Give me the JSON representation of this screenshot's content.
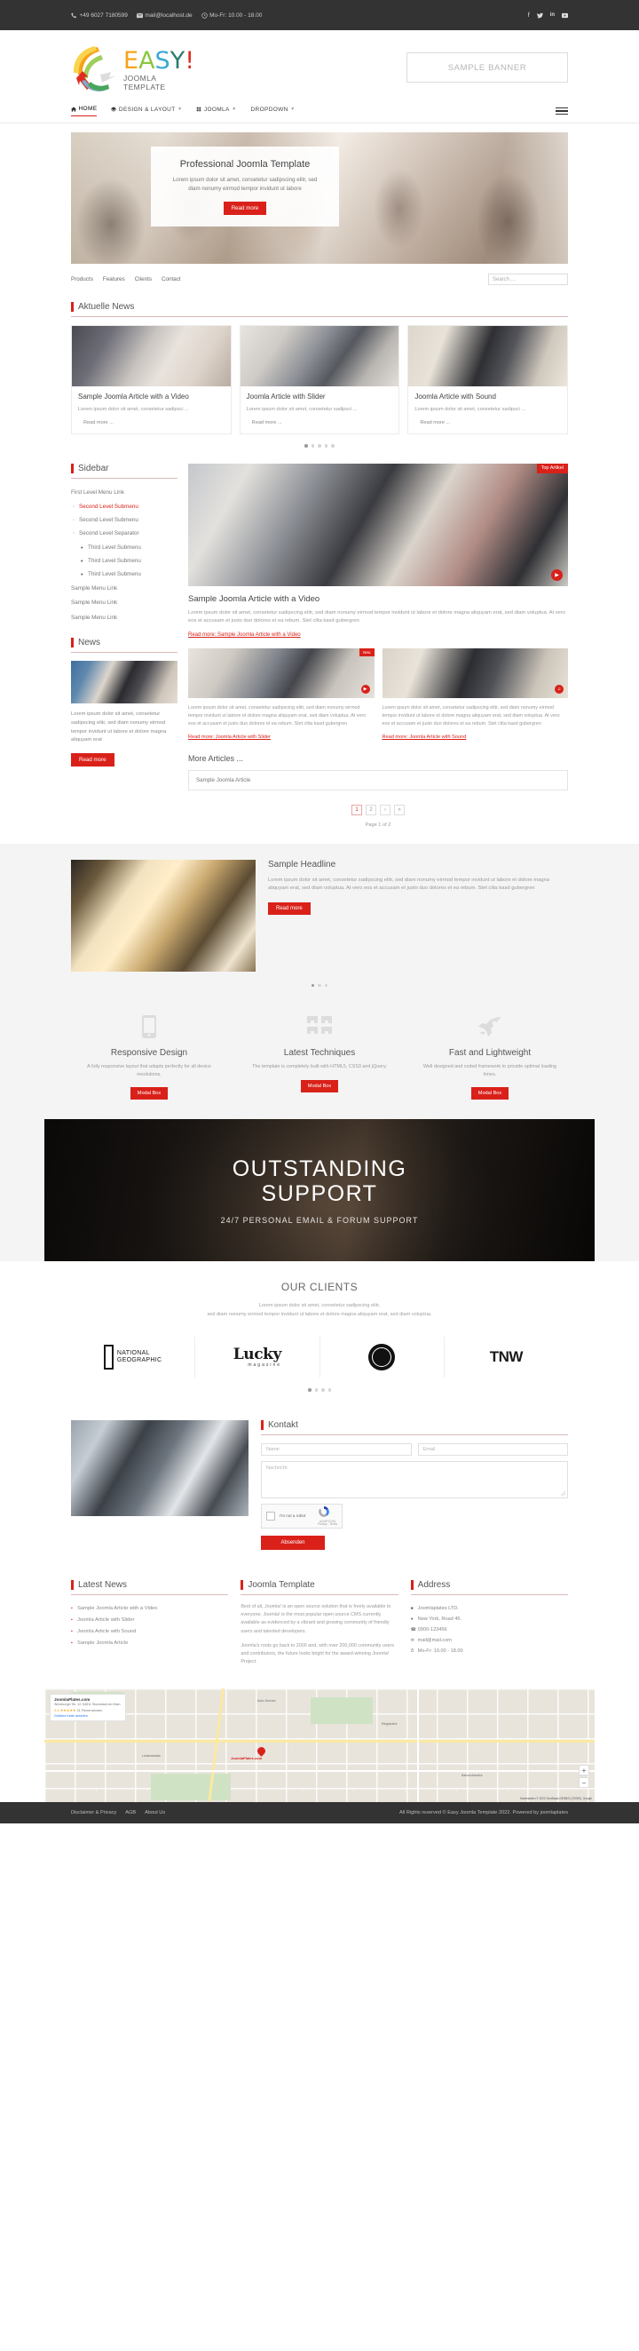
{
  "topbar": {
    "phone": "+49 6027 7180599",
    "email": "mail@localhost.de",
    "hours": "Mo-Fr: 10.00 - 18.00",
    "social": [
      "facebook-icon",
      "twitter-icon",
      "linkedin-icon",
      "youtube-icon"
    ]
  },
  "header": {
    "logo_main": "EASY!",
    "logo_sub_line1": "JOOMLA",
    "logo_sub_line2": "TEMPLATE",
    "banner_text": "SAMPLE BANNER"
  },
  "nav": {
    "items": [
      {
        "label": "HOME",
        "icon": "home-icon",
        "caret": false,
        "active": true
      },
      {
        "label": "DESIGN & LAYOUT",
        "icon": "layers-icon",
        "caret": true,
        "active": false
      },
      {
        "label": "JOOMLA",
        "icon": "joomla-icon",
        "caret": true,
        "active": false
      },
      {
        "label": "DROPDOWN",
        "icon": "",
        "caret": true,
        "active": false
      }
    ],
    "burger": "hamburger-menu-icon"
  },
  "slider": {
    "title": "Professional Joomla Template",
    "text": "Lorem ipsum dolor sit amet, consetetur sadipscing elitr, sed diam nonumy eirmod tempor invidunt ut labore",
    "button": "Read more"
  },
  "submenu": {
    "items": [
      "Products",
      "Features",
      "Clients",
      "Contact"
    ],
    "search_placeholder": "Search ..."
  },
  "news": {
    "heading": "Aktuelle News",
    "cards": [
      {
        "title": "Sample Joomla Article with a Video",
        "text": "Lorem ipsum dolor sit amet, consetetur sadipsci ...",
        "more": "Read more ..."
      },
      {
        "title": "Joomla Article with Slider",
        "text": "Lorem ipsum dolor sit amet, consetetur sadipsci ...",
        "more": "Read more ..."
      },
      {
        "title": "Joomla Article with Sound",
        "text": "Lorem ipsum dolor sit amet, consetetur sadipsci ...",
        "more": "Read more ..."
      }
    ],
    "dots": 5,
    "active_dot": 1
  },
  "sidebar": {
    "heading": "Sidebar",
    "menu": [
      {
        "label": "First Level Menu Link",
        "level": 1,
        "active": false
      },
      {
        "label": "Second Level Submenu",
        "level": 2,
        "active": true
      },
      {
        "label": "Second Level Submenu",
        "level": 2,
        "active": false
      },
      {
        "label": "Second Level Separator",
        "level": 2,
        "active": false
      },
      {
        "label": "Third Level Submenu",
        "level": 3,
        "active": false
      },
      {
        "label": "Third Level Submenu",
        "level": 3,
        "active": false
      },
      {
        "label": "Third Level Submenu",
        "level": 3,
        "active": false
      },
      {
        "label": "Sample Menu Link",
        "level": 1,
        "active": false
      },
      {
        "label": "Sample Menu Link",
        "level": 1,
        "active": false
      },
      {
        "label": "Sample Menu Link",
        "level": 1,
        "active": false
      }
    ],
    "news_heading": "News",
    "news_text": "Lorem ipsum dolor sit amet, consetetur sadipscing elitr, sed diam nonumy eirmod tempor invidunt ut labore et dolore magna aliquyam erat",
    "news_button": "Read more"
  },
  "article": {
    "badge": "Top Artikel",
    "media_icon": "video-icon",
    "title": "Sample Joomla Article with a Video",
    "text": "Lorem ipsum dolor sit amet, consetetur sadipscing elitr, sed diam nonumy eirmod tempor invidunt ut labore et dolore magna aliquyam erat, sed diam voluptua. At vero eos et accusam et justo duo dolores et ea rebum. Stet clita kasd gubergren",
    "link": "Read more: Sample Joomla Article with a Video",
    "sub": [
      {
        "badge": "Neu",
        "media_icon": "slider-icon",
        "text": "Lorem ipsum dolor sit amet, consetetur sadipscing elitr, sed diam nonumy eirmod tempor invidunt ut labore et dolore magna aliquyam erat, sed diam voluptua. At vero eos et accusam et justo duo dolores et ea rebum. Stet clita kasd gubergren",
        "link": "Read more: Joomla Article with Slider"
      },
      {
        "badge": "",
        "media_icon": "sound-icon",
        "text": "Lorem ipsum dolor sit amet, consetetur sadipscing elitr, sed diam nonumy eirmod tempor invidunt ut labore et dolore magna aliquyam erat, sed diam voluptua. At vero eos et accusam et justo duo dolores et ea rebum. Stet clita kasd gubergren",
        "link": "Read more: Joomla Article with Sound"
      }
    ],
    "more_title": "More Articles ...",
    "more_item": "Sample Joomla Article",
    "pager": [
      "1",
      "2",
      "›",
      "»"
    ],
    "pager_current": "1",
    "page_info": "Page 1 of 2"
  },
  "feature": {
    "title": "Sample Headline",
    "text": "Lorem ipsum dolor sit amet, consetetur sadipscing elitr, sed diam nonumy eirmod tempor invidunt ut labore et dolore magna aliquyam erat, sed diam voluptua. At vero eos et accusam et justo duo dolores et ea rebum. Stet clita kasd gubergren",
    "button": "Read more",
    "dots": 3,
    "active_dot": 1
  },
  "services": [
    {
      "icon": "mobile-phone-icon",
      "title": "Responsive Design",
      "text": "A fully responsive layout that adapts perfectly for all device resolutions.",
      "button": "Modal Box"
    },
    {
      "icon": "blocks-icon",
      "title": "Latest Techniques",
      "text": "The template is completely built with HTML5, CSS3 and jQuery.",
      "button": "Modal Box"
    },
    {
      "icon": "rocket-icon",
      "title": "Fast and Lightweight",
      "text": "Well designed and coded framework to provide optimal loading times.",
      "button": "Modal Box"
    }
  ],
  "support": {
    "line1": "OUTSTANDING",
    "line2": "SUPPORT",
    "subtitle": "24/7 PERSONAL EMAIL & FORUM SUPPORT"
  },
  "clients": {
    "title": "OUR CLIENTS",
    "text_line1": "Lorem ipsum dolor sit amet, consetetur sadipscing elitr,",
    "text_line2": "sed diam nonumy eirmod tempor invidunt ut labore et dolore magna aliquyam erat, sed diam voluptua.",
    "logos": [
      {
        "name": "NATIONAL GEOGRAPHIC",
        "line1": "NATIONAL",
        "line2": "GEOGRAPHIC"
      },
      {
        "name": "Lucky magazine",
        "line1": "Lucky",
        "line2": "magazine"
      },
      {
        "name": "Starbucks",
        "line1": "",
        "line2": ""
      },
      {
        "name": "TNW",
        "line1": "TNW",
        "line2": ""
      }
    ],
    "dots": 4,
    "active_dot": 1
  },
  "contact": {
    "heading": "Kontakt",
    "name_placeholder": "Name",
    "email_placeholder": "Email",
    "message_placeholder": "Nachricht",
    "captcha_label": "I'm not a robot",
    "captcha_brand": "reCAPTCHA",
    "captcha_terms": "Privacy - Terms",
    "submit": "Absenden"
  },
  "footer": {
    "col1_heading": "Latest News",
    "col1_items": [
      "Sample Joomla Article with a Video",
      "Joomla Article with Slider",
      "Joomla Article with Sound",
      "Sample Joomla Article"
    ],
    "col2_heading": "Joomla Template",
    "col2_p1": "Best of all, Joomla! is an open source solution that is freely available to everyone. Joomla! is the most popular open source CMS currently available as evidenced by a vibrant and growing community of friendly users and talented developers.",
    "col2_p2": "Joomla's roots go back to 2000 and, with over 200,000 community users and contributors, the future looks bright for the award-winning Joomla! Project.",
    "col3_heading": "Address",
    "col3_items": [
      {
        "icon": "building-icon",
        "text": "Joomlaplates LTD."
      },
      {
        "icon": "map-marker-icon",
        "text": "New York, Road 45."
      },
      {
        "icon": "phone-icon",
        "text": "0900-123456"
      },
      {
        "icon": "envelope-icon",
        "text": "mail@mail.com"
      },
      {
        "icon": "clock-icon",
        "text": "Mo-Fr: 10.00 - 18.00"
      }
    ]
  },
  "map": {
    "business_name": "JoomlaPlates.com",
    "address": "Würzburger Str. 12, 63811 Stockstadt am Main",
    "rating": "4.8",
    "stars": "★★★★★",
    "reviews": "11 Rezensionen",
    "view_link": "Größere Karte ansehen",
    "pin_label": "JoomlaPlates.com",
    "attribution": "Kartendaten © 2022 GeoBasis-DE/BKG (©2009), Google",
    "zoom_in": "+",
    "zoom_out": "−"
  },
  "bottom": {
    "links": [
      "Disclaimer & Privacy",
      "AGB",
      "About Us"
    ],
    "copyright": "All Rights reserved © Easy Joomla Template 2022. Powered by joomlaplates"
  }
}
